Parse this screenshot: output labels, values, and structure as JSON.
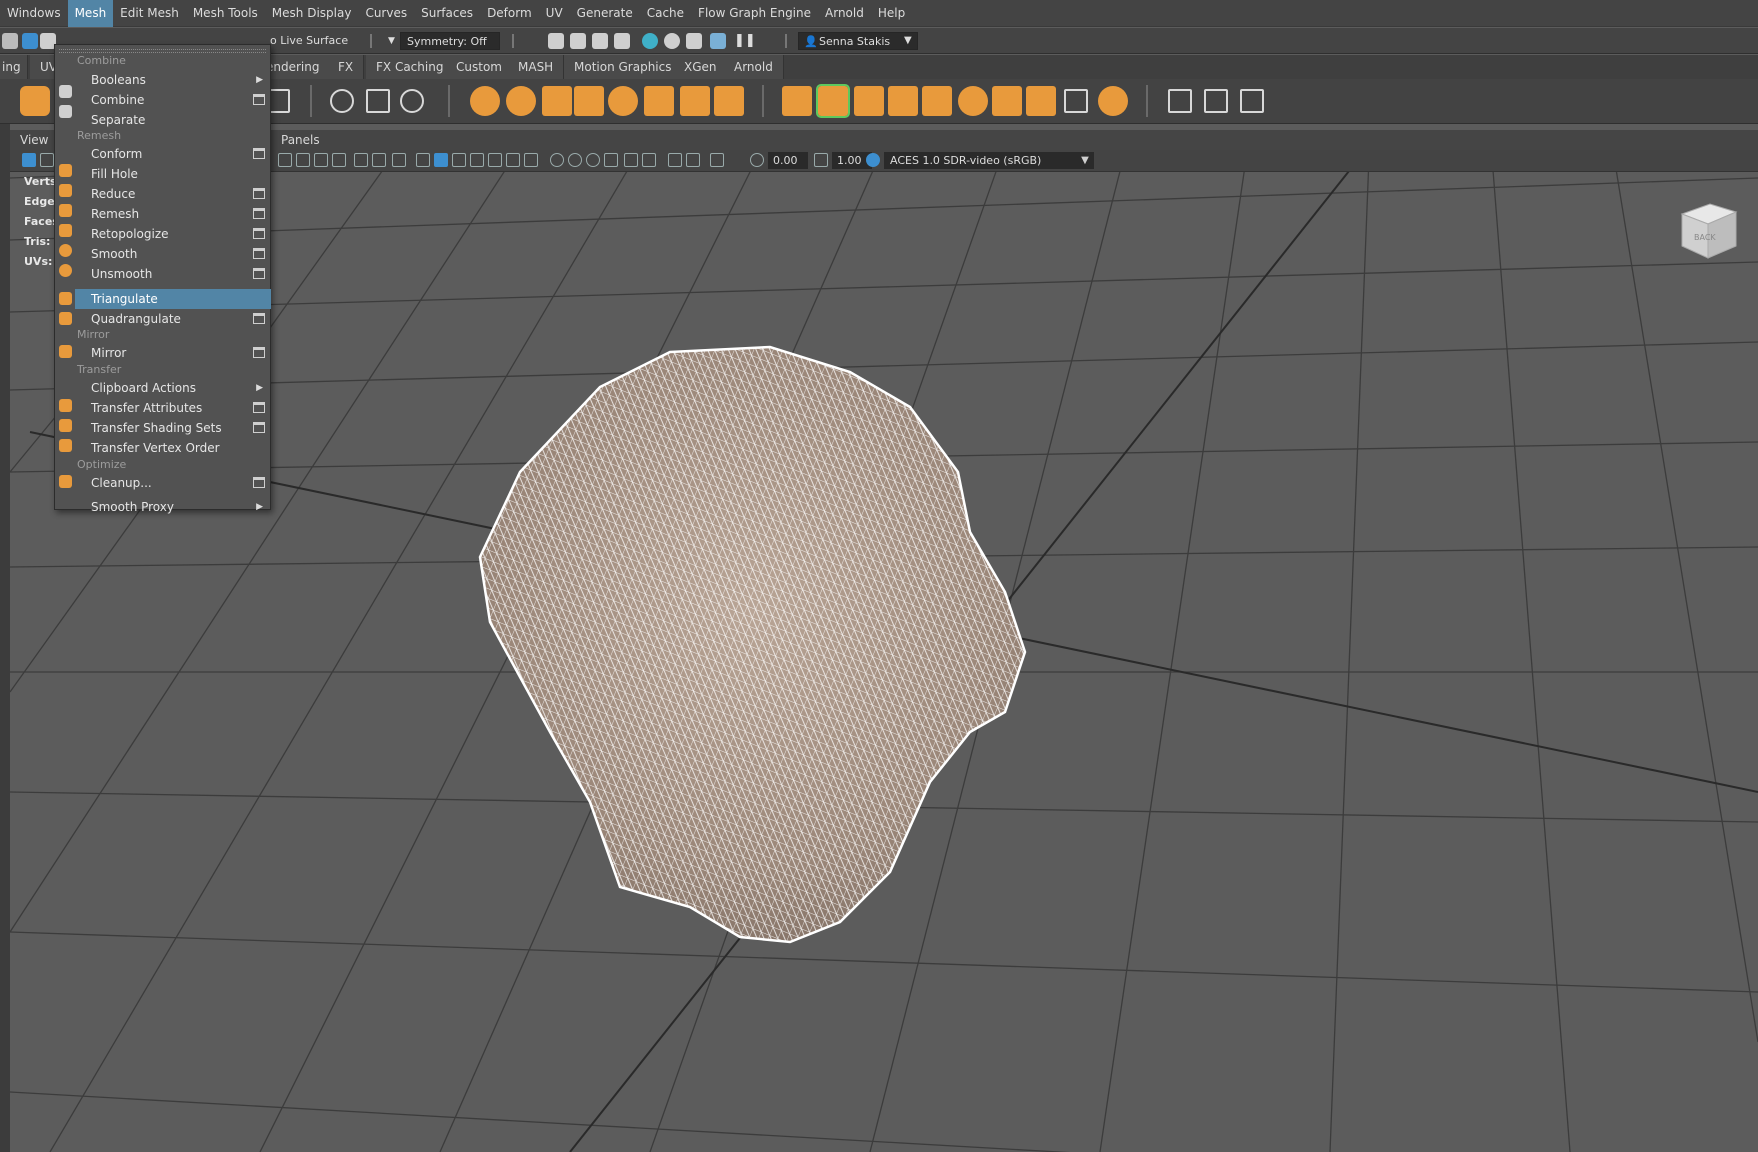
{
  "menubar": {
    "items": [
      "Windows",
      "Mesh",
      "Edit Mesh",
      "Mesh Tools",
      "Mesh Display",
      "Curves",
      "Surfaces",
      "Deform",
      "UV",
      "Generate",
      "Cache",
      "Flow Graph Engine",
      "Arnold",
      "Help"
    ],
    "active_index": 1
  },
  "statusline": {
    "live_surface": "o Live Surface",
    "symmetry": "Symmetry: Off",
    "user": "Senna Stakis"
  },
  "shelf_tabs": [
    "ing",
    "UV",
    "endering",
    "FX",
    "FX Caching",
    "Custom",
    "MASH",
    "Motion Graphics",
    "XGen",
    "Arnold"
  ],
  "panel": {
    "view_menu": "View",
    "panels_menu": "Panels",
    "exposure": "0.00",
    "gamma": "1.00",
    "color_space": "ACES 1.0 SDR-video (sRGB)"
  },
  "hud": {
    "verts": "Verts:",
    "edges": "Edges:",
    "faces": "Faces:",
    "tris": "Tris:",
    "uvs": "UVs:"
  },
  "viewcube": {
    "label": "BACK"
  },
  "mesh_menu": {
    "sections": {
      "combine": "Combine",
      "remesh": "Remesh",
      "mirror": "Mirror",
      "transfer": "Transfer",
      "optimize": "Optimize"
    },
    "items": [
      {
        "label": "Booleans",
        "submenu": true
      },
      {
        "label": "Combine",
        "option": true
      },
      {
        "label": "Separate"
      },
      {
        "label": "Conform",
        "option": true
      },
      {
        "label": "Fill Hole"
      },
      {
        "label": "Reduce",
        "option": true
      },
      {
        "label": "Remesh",
        "option": true
      },
      {
        "label": "Retopologize",
        "option": true
      },
      {
        "label": "Smooth",
        "option": true
      },
      {
        "label": "Unsmooth",
        "option": true
      },
      {
        "label": "Triangulate",
        "highlighted": true
      },
      {
        "label": "Quadrangulate",
        "option": true
      },
      {
        "label": "Mirror",
        "option": true
      },
      {
        "label": "Clipboard Actions",
        "submenu": true
      },
      {
        "label": "Transfer Attributes",
        "option": true
      },
      {
        "label": "Transfer Shading Sets",
        "option": true
      },
      {
        "label": "Transfer Vertex Order"
      },
      {
        "label": "Cleanup...",
        "option": true
      },
      {
        "label": "Smooth Proxy",
        "submenu": true
      }
    ]
  },
  "colors": {
    "highlight": "#5285a6",
    "shelf_orange": "#e89a3c",
    "viewport_bg": "#5c5c5c",
    "wireframe": "#ffffff",
    "mesh_fill": "#a68f80"
  }
}
